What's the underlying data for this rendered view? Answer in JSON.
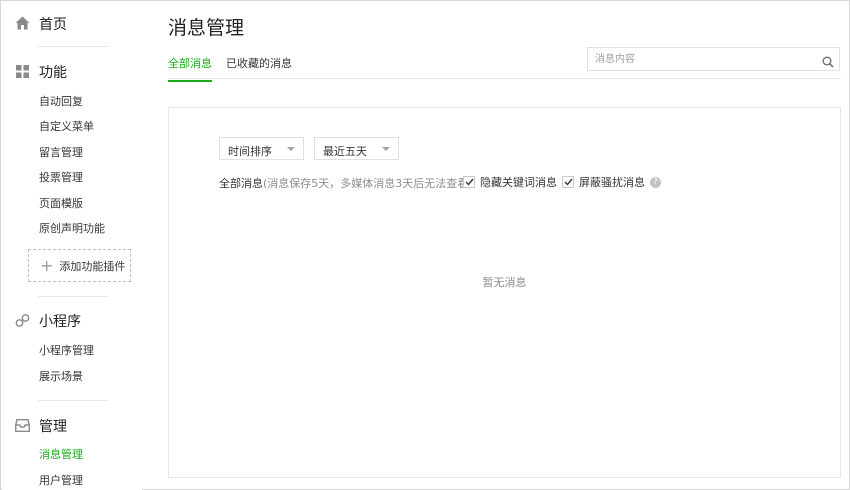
{
  "sidebar": {
    "home": {
      "label": "首页",
      "icon": "home-icon"
    },
    "features": {
      "label": "功能",
      "icon": "grid-icon",
      "items": [
        "自动回复",
        "自定义菜单",
        "留言管理",
        "投票管理",
        "页面模版",
        "原创声明功能"
      ],
      "add_plugin": "添加功能插件"
    },
    "miniprogram": {
      "label": "小程序",
      "icon": "link-icon",
      "items": [
        "小程序管理",
        "展示场景"
      ]
    },
    "manage": {
      "label": "管理",
      "icon": "inbox-icon",
      "items": [
        "消息管理",
        "用户管理"
      ],
      "active": "消息管理"
    }
  },
  "main": {
    "title": "消息管理",
    "tabs": [
      {
        "label": "全部消息",
        "active": true
      },
      {
        "label": "已收藏的消息",
        "active": false
      }
    ],
    "search": {
      "placeholder": "消息内容",
      "value": ""
    },
    "selects": {
      "sort": "时间排序",
      "range": "最近五天"
    },
    "filter": {
      "label": "全部消息",
      "hint": "(消息保存5天，多媒体消息3天后无法查看)",
      "hide_keyword": {
        "label": "隐藏关键词消息",
        "checked": true
      },
      "block_spam": {
        "label": "屏蔽骚扰消息",
        "checked": true
      }
    },
    "empty": "暂无消息"
  },
  "colors": {
    "accent": "#1aad19",
    "text": "#353535",
    "muted": "#8d8d8d",
    "border": "#e7e7e7"
  }
}
